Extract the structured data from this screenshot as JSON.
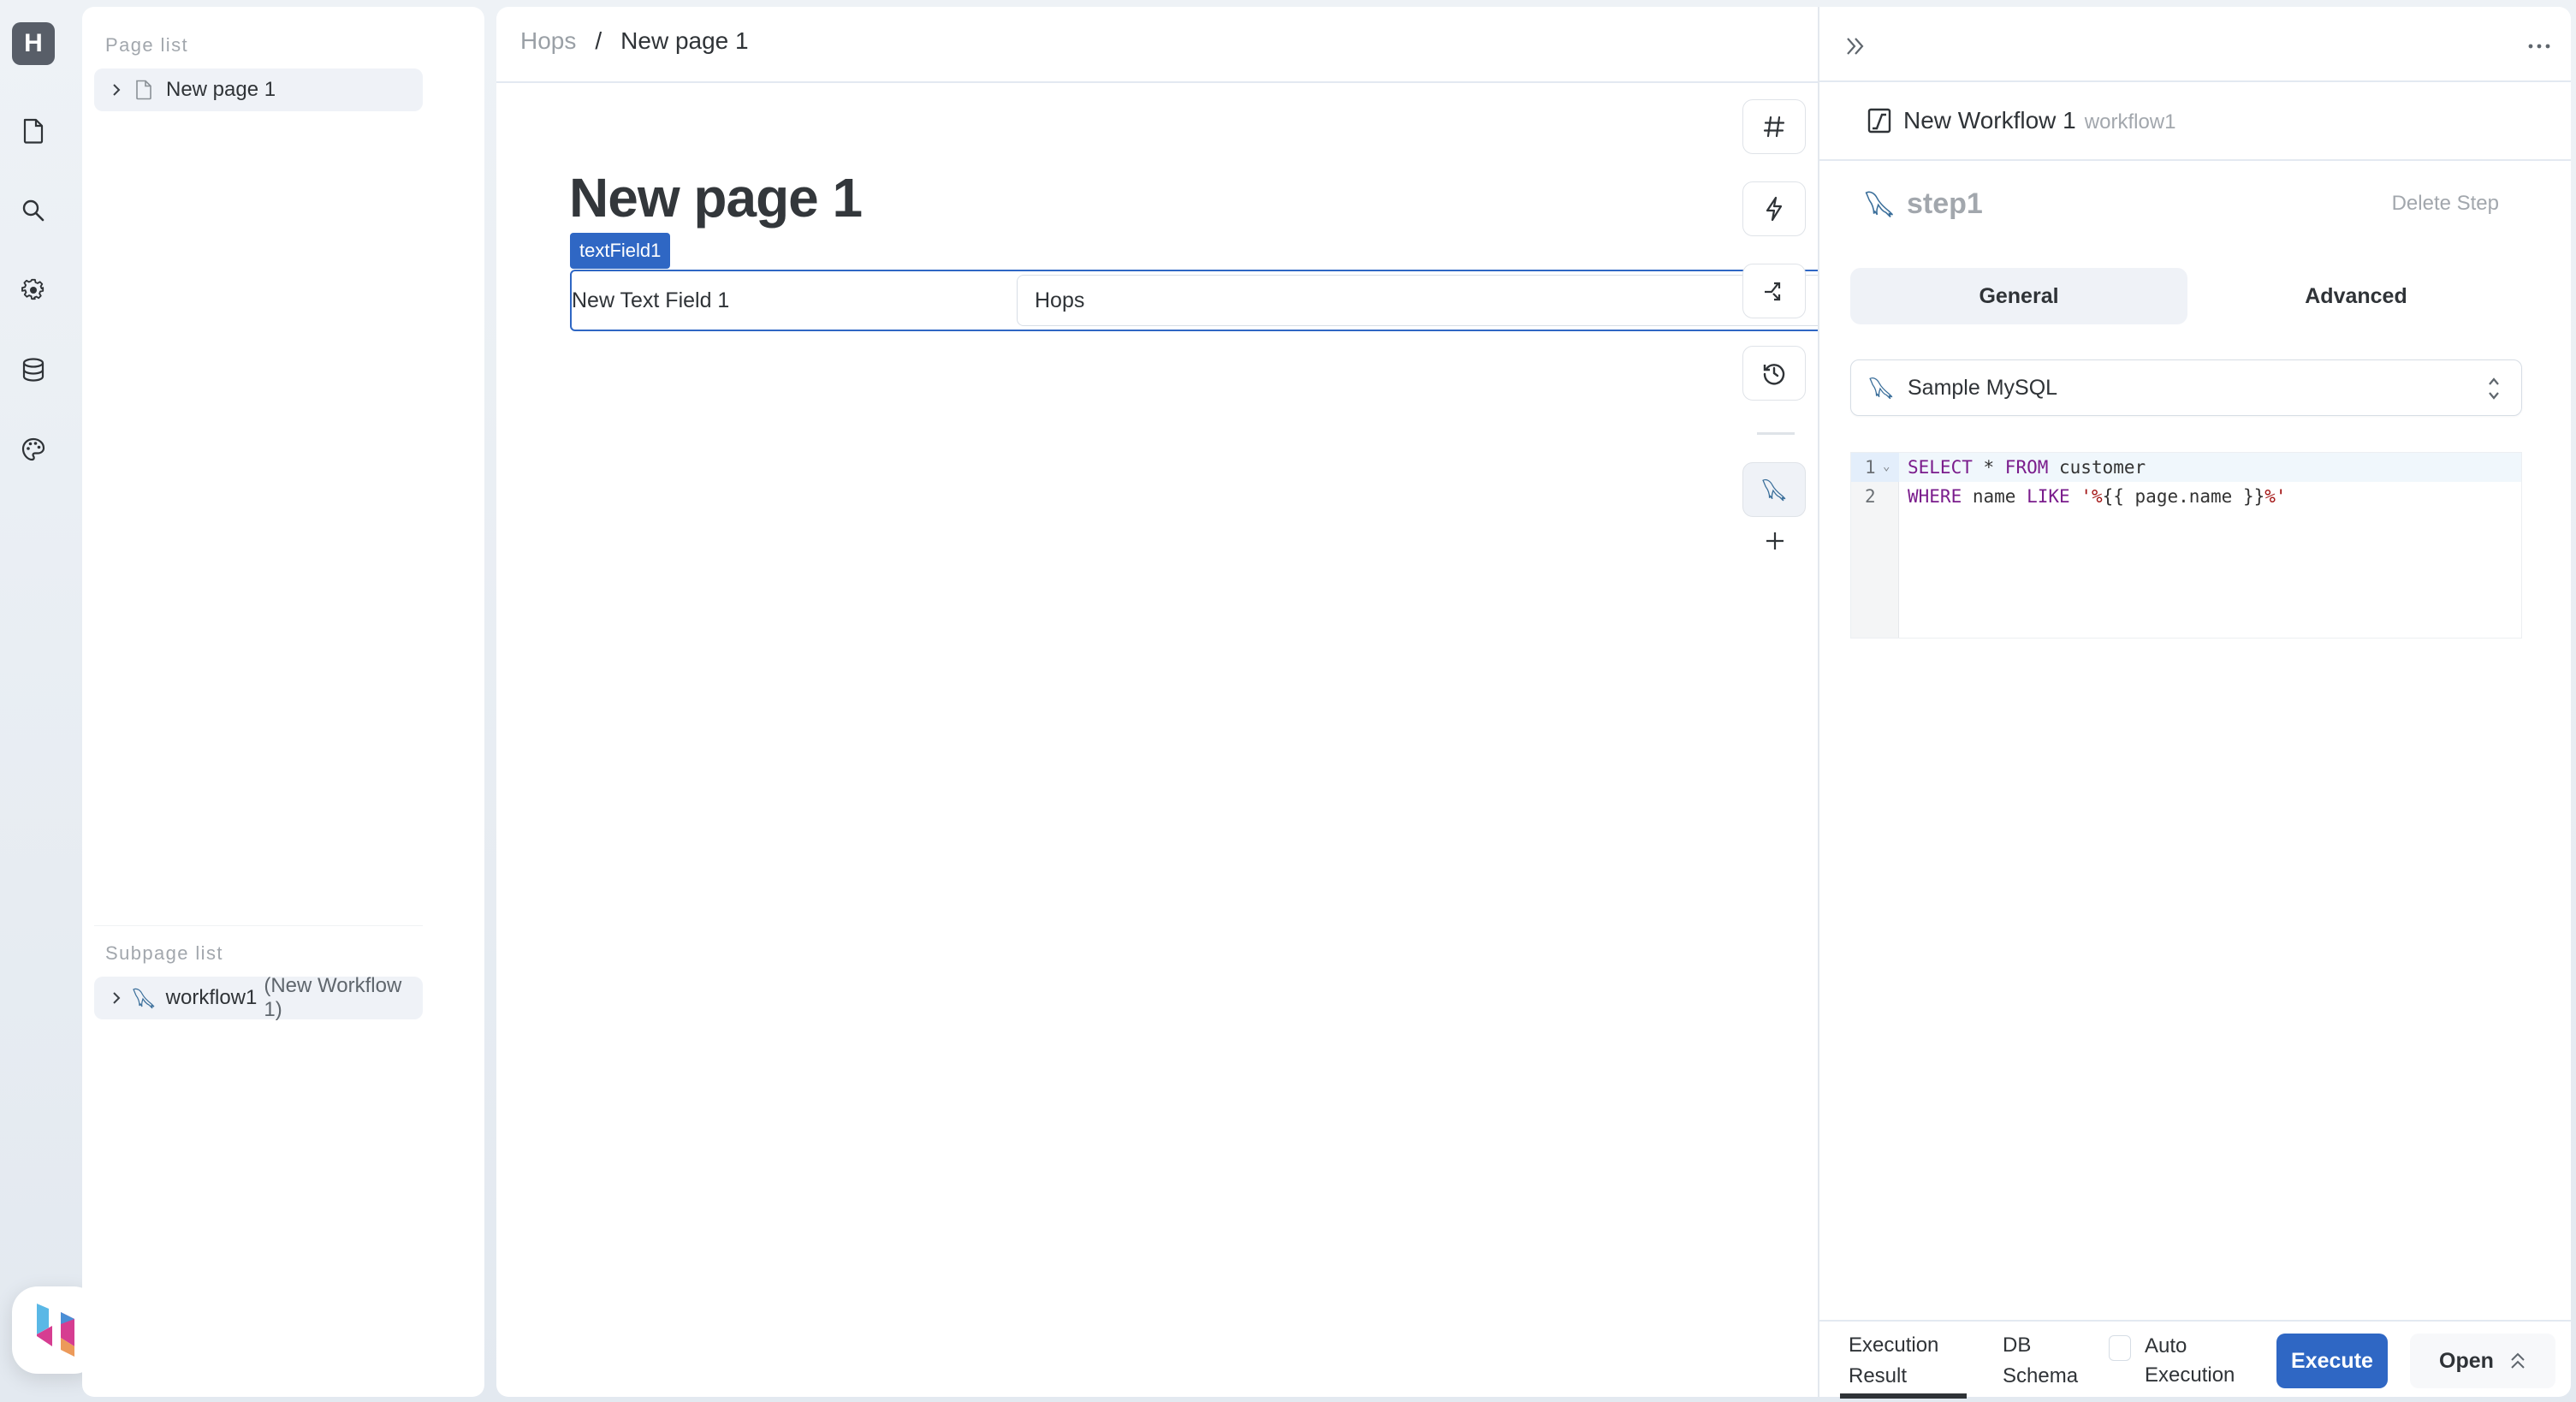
{
  "app": {
    "workspace_initial": "H",
    "rail_items": [
      {
        "name": "pages",
        "icon": "file-icon"
      },
      {
        "name": "search",
        "icon": "search-icon"
      },
      {
        "name": "settings",
        "icon": "gear-icon"
      },
      {
        "name": "database",
        "icon": "database-icon"
      },
      {
        "name": "theme",
        "icon": "palette-icon"
      }
    ],
    "brand_colors": {
      "accent": "#2f67c4",
      "text": "#2f3337",
      "muted": "#a2a7ad"
    }
  },
  "page_list": {
    "title": "Page list",
    "items": [
      {
        "label": "New page 1",
        "icon": "file-icon"
      }
    ]
  },
  "subpage_list": {
    "title": "Subpage list",
    "items": [
      {
        "label": "workflow1",
        "detail": "(New Workflow 1)",
        "icon": "mysql-dolphin-icon"
      }
    ]
  },
  "canvas": {
    "breadcrumb": {
      "root": "Hops",
      "separator": "/",
      "current": "New page 1"
    },
    "page_title": "New page 1",
    "component": {
      "tag": "textField1",
      "label": "New Text Field 1",
      "value": "Hops"
    },
    "tools": [
      {
        "name": "variables",
        "icon": "hash-icon"
      },
      {
        "name": "events",
        "icon": "lightning-icon"
      },
      {
        "name": "flow",
        "icon": "shuffle-icon"
      },
      {
        "name": "history",
        "icon": "history-icon"
      },
      {
        "name": "workflow",
        "icon": "mysql-dolphin-icon"
      }
    ]
  },
  "inspector": {
    "workflow_title": "New Workflow 1",
    "workflow_id": "workflow1",
    "step_name": "step1",
    "delete_step": "Delete Step",
    "tabs": [
      {
        "label": "General",
        "active": true
      },
      {
        "label": "Advanced",
        "active": false
      }
    ],
    "datasource": "Sample MySQL",
    "code_lines": [
      {
        "num": "1",
        "tokens": [
          {
            "t": "SELECT",
            "c": "kw"
          },
          {
            "t": " * ",
            "c": ""
          },
          {
            "t": "FROM",
            "c": "kw"
          },
          {
            "t": " customer",
            "c": ""
          }
        ]
      },
      {
        "num": "2",
        "tokens": [
          {
            "t": "WHERE",
            "c": "kw"
          },
          {
            "t": " name ",
            "c": ""
          },
          {
            "t": "LIKE",
            "c": "kw"
          },
          {
            "t": " ",
            "c": ""
          },
          {
            "t": "'%",
            "c": "str"
          },
          {
            "t": "{{ page.name }}",
            "c": ""
          },
          {
            "t": "%'",
            "c": "str"
          }
        ]
      }
    ],
    "bottom": {
      "tab_result_line1": "Execution",
      "tab_result_line2": "Result",
      "tab_schema_line1": "DB",
      "tab_schema_line2": "Schema",
      "auto_exec_line1": "Auto",
      "auto_exec_line2": "Execution",
      "auto_exec_checked": false,
      "execute": "Execute",
      "open": "Open"
    }
  }
}
